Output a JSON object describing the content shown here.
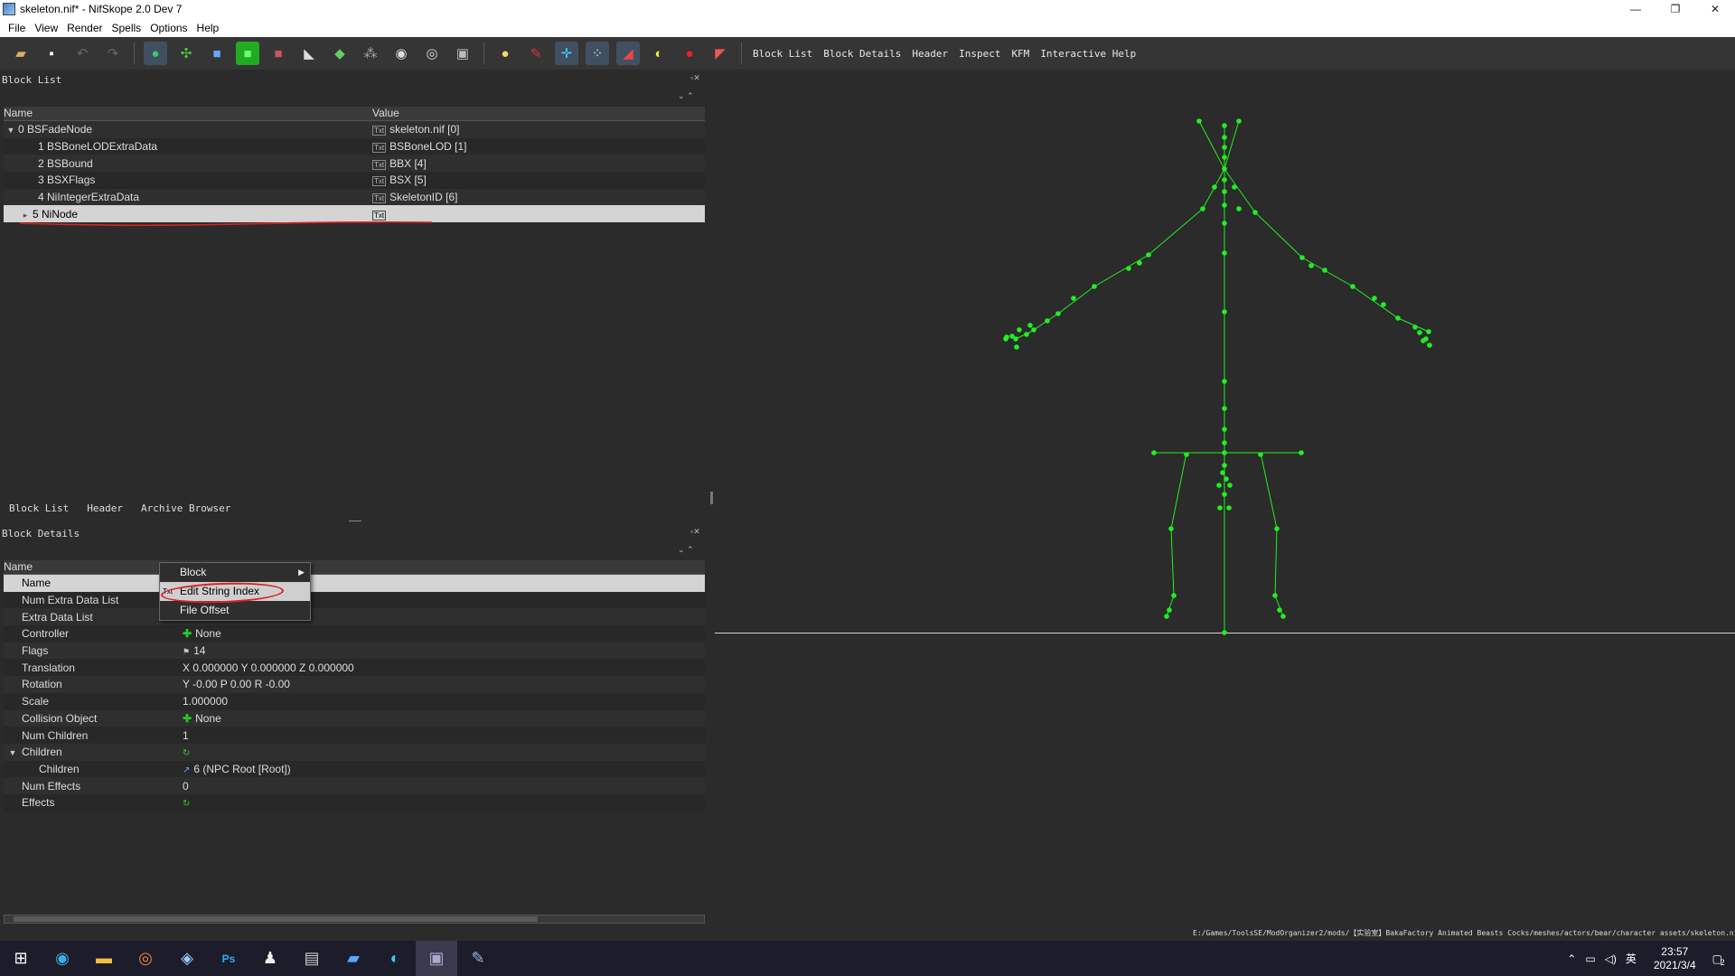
{
  "window": {
    "title": "skeleton.nif* - NifSkope 2.0 Dev 7",
    "controls": [
      "—",
      "❐",
      "✕"
    ]
  },
  "menubar": [
    "File",
    "View",
    "Render",
    "Spells",
    "Options",
    "Help"
  ],
  "toolbar": {
    "text_buttons": [
      "Block List",
      "Block Details",
      "Header",
      "Inspect",
      "KFM",
      "Interactive Help"
    ]
  },
  "block_list": {
    "title": "Block List",
    "columns": [
      "Name",
      "Value"
    ],
    "rows": [
      {
        "name": "0 BSFadeNode",
        "value": "skeleton.nif [0]",
        "indent": 0,
        "expanded": true
      },
      {
        "name": "1 BSBoneLODExtraData",
        "value": "BSBoneLOD [1]",
        "indent": 1
      },
      {
        "name": "2 BSBound",
        "value": "BBX [4]",
        "indent": 1
      },
      {
        "name": "3 BSXFlags",
        "value": "BSX [5]",
        "indent": 1
      },
      {
        "name": "4 NiIntegerExtraData",
        "value": "SkeletonID [6]",
        "indent": 1
      },
      {
        "name": "5 NiNode",
        "value": "",
        "indent": 1,
        "selected": true
      }
    ]
  },
  "mid_tabs": [
    "Block List",
    "Header",
    "Archive Browser"
  ],
  "block_details": {
    "title": "Block Details",
    "columns": [
      "Name",
      "Value"
    ],
    "rows": [
      {
        "name": "Name",
        "value": "",
        "selected": true
      },
      {
        "name": "Num Extra Data List",
        "value": ""
      },
      {
        "name": "Extra Data List",
        "value": ""
      },
      {
        "name": "Controller",
        "value": "None",
        "icon": "plus"
      },
      {
        "name": "Flags",
        "value": "14",
        "icon": "flag"
      },
      {
        "name": "Translation",
        "value": "X 0.000000 Y 0.000000 Z 0.000000"
      },
      {
        "name": "Rotation",
        "value": "Y -0.00 P 0.00 R -0.00"
      },
      {
        "name": "Scale",
        "value": "1.000000"
      },
      {
        "name": "Collision Object",
        "value": "None",
        "icon": "plus"
      },
      {
        "name": "Num Children",
        "value": "1"
      },
      {
        "name": "Children",
        "value": "",
        "icon": "refresh",
        "expanded": true
      },
      {
        "name": "Children",
        "value": "6 (NPC Root [Root])",
        "icon": "link",
        "indent": 1
      },
      {
        "name": "Num Effects",
        "value": "0"
      },
      {
        "name": "Effects",
        "value": "",
        "icon": "refresh"
      }
    ]
  },
  "context_menu": {
    "items": [
      "Block",
      "Edit String Index",
      "File Offset"
    ],
    "highlighted": "Edit String Index"
  },
  "status_path": "E:/Games/ToolsSE/ModOrganizer2/mods/【实验室】BakaFactory Animated Beasts Cocks/meshes/actors/bear/character assets/skeleton.nif",
  "tray": {
    "ime": "英",
    "time": "23:57",
    "date": "2021/3/4",
    "notifications": "2"
  },
  "colors": {
    "skeleton": "#22ee22",
    "background": "#2b2b2b",
    "selection": "#d4d4d4",
    "annotation": "#dd2222"
  }
}
